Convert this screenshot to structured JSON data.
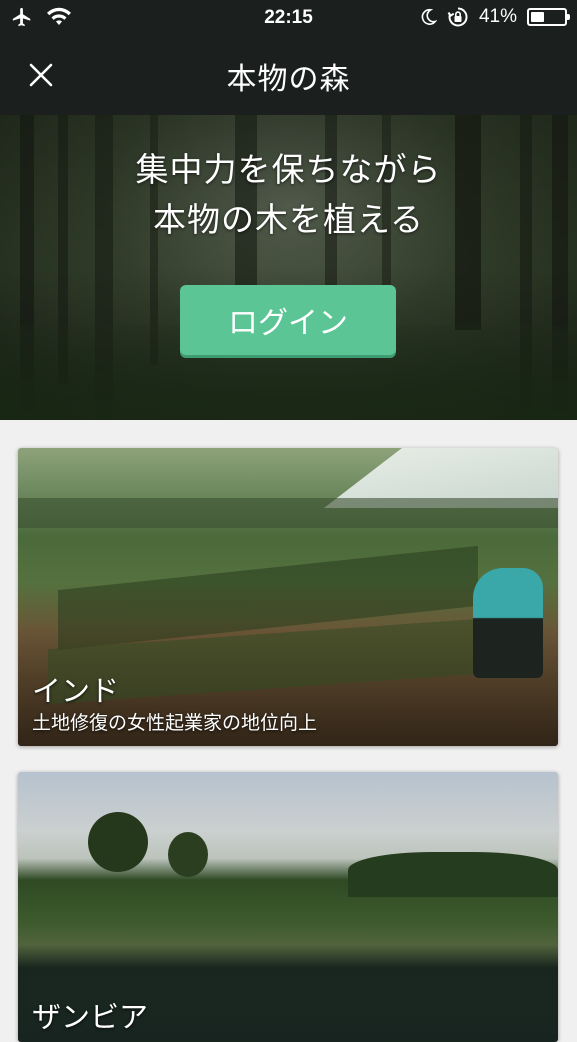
{
  "status_bar": {
    "time": "22:15",
    "battery_text": "41%",
    "battery_level": 0.41,
    "icons": [
      "airplane-icon",
      "wifi-icon",
      "moon-icon",
      "rotation-lock-icon",
      "battery-icon"
    ]
  },
  "navbar": {
    "title": "本物の森",
    "close_icon": "close-icon"
  },
  "hero": {
    "headline_line1": "集中力を保ちながら",
    "headline_line2": "本物の木を植える",
    "login_label": "ログイン"
  },
  "cards": [
    {
      "title": "インド",
      "subtitle": "土地修復の女性起業家の地位向上"
    },
    {
      "title": "ザンビア",
      "subtitle": ""
    }
  ],
  "colors": {
    "bar_background": "#1b201e",
    "login_button": "#5cc596",
    "page_background": "#f0f0f0"
  }
}
